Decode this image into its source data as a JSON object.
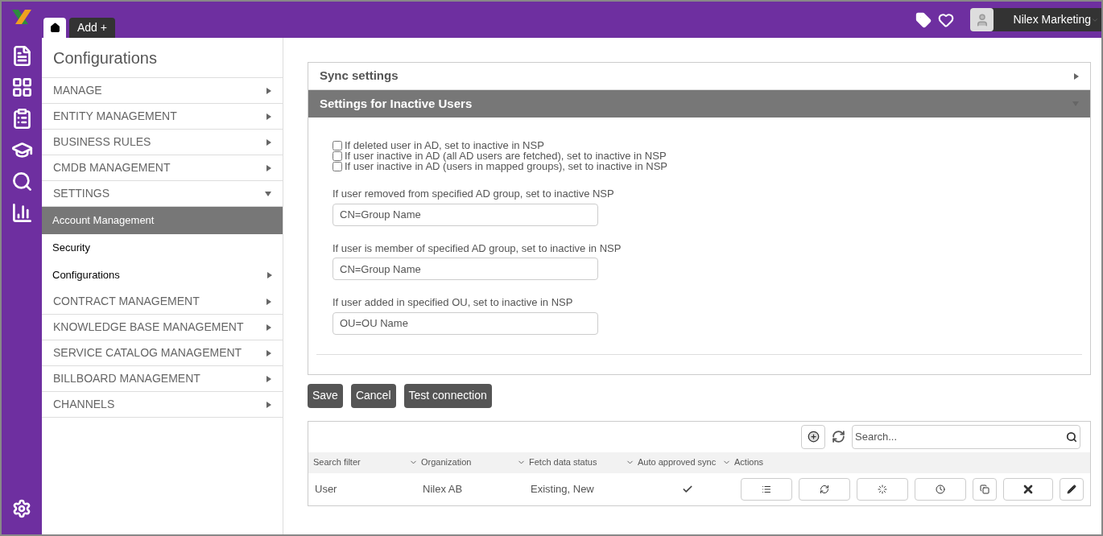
{
  "tabs": [
    {
      "kind": "home",
      "selected": true
    },
    {
      "kind": "add",
      "label": "Add +",
      "selected": false
    }
  ],
  "user": {
    "name": "Nilex Marketing"
  },
  "sidebar": {
    "title": "Configurations",
    "items": [
      {
        "label": "MANAGE",
        "expanded": false
      },
      {
        "label": "ENTITY MANAGEMENT",
        "expanded": false
      },
      {
        "label": "BUSINESS RULES",
        "expanded": false
      },
      {
        "label": "CMDB MANAGEMENT",
        "expanded": false
      },
      {
        "label": "SETTINGS",
        "expanded": true,
        "children": [
          {
            "label": "Account Management",
            "selected": true,
            "has_arrow": false
          },
          {
            "label": "Security",
            "selected": false,
            "has_arrow": false
          },
          {
            "label": "Configurations",
            "selected": false,
            "has_arrow": true
          }
        ]
      },
      {
        "label": "CONTRACT MANAGEMENT",
        "expanded": false
      },
      {
        "label": "KNOWLEDGE BASE MANAGEMENT",
        "expanded": false
      },
      {
        "label": "SERVICE CATALOG MANAGEMENT",
        "expanded": false
      },
      {
        "label": "BILLBOARD MANAGEMENT",
        "expanded": false
      },
      {
        "label": "CHANNELS",
        "expanded": false
      }
    ]
  },
  "panels": [
    {
      "title": "Sync settings",
      "expanded": false
    },
    {
      "title": "Settings for Inactive Users",
      "expanded": true
    }
  ],
  "checkboxes": [
    {
      "label": "If deleted user in AD, set to inactive in NSP",
      "checked": false
    },
    {
      "label": "If user inactive in AD (all AD users are fetched), set to inactive in NSP",
      "checked": false
    },
    {
      "label": "If user inactive in AD (users in mapped groups), set to inactive in NSP",
      "checked": false
    }
  ],
  "fields": [
    {
      "label": "If user removed from specified AD group, set to inactive NSP",
      "placeholder": "CN=Group Name"
    },
    {
      "label": "If user is member of specified AD group, set to inactive in NSP",
      "placeholder": "CN=Group Name"
    },
    {
      "label": "If user added in specified OU, set to inactive in NSP",
      "placeholder": "OU=OU Name"
    }
  ],
  "buttons": [
    "Save",
    "Cancel",
    "Test connection"
  ],
  "table": {
    "search_placeholder": "Search...",
    "columns": [
      "Search filter",
      "Organization",
      "Fetch data status",
      "Auto approved sync",
      "Actions"
    ],
    "rows": [
      {
        "search_filter": "User",
        "organization": "Nilex AB",
        "fetch_data_status": "Existing, New",
        "auto_approved": true
      }
    ]
  }
}
